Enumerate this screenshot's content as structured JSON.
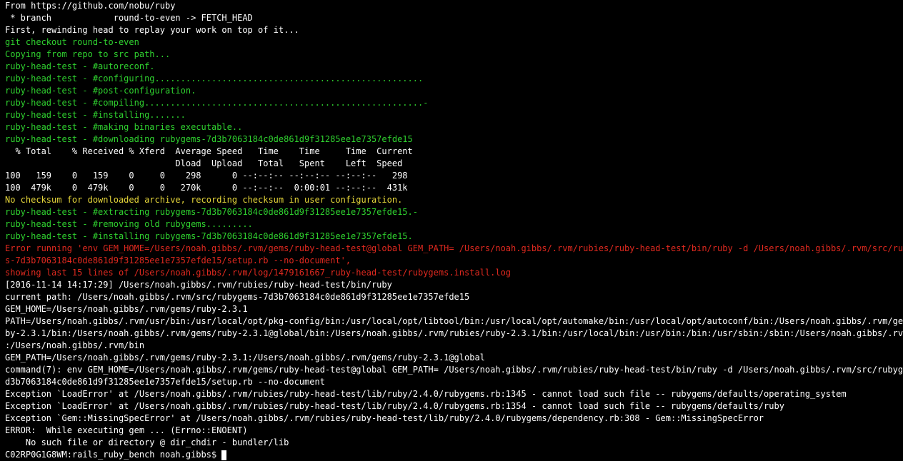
{
  "terminal": {
    "colors": {
      "background": "#000000",
      "default": "#ffffff",
      "green": "#2fd12f",
      "yellow": "#e5d63a",
      "red": "#e0291f"
    },
    "lines": [
      {
        "text": "From https://github.com/nobu/ruby",
        "color": "white"
      },
      {
        "text": " * branch            round-to-even -> FETCH_HEAD",
        "color": "white"
      },
      {
        "text": "First, rewinding head to replay your work on top of it...",
        "color": "white"
      },
      {
        "text": "git checkout round-to-even",
        "color": "green"
      },
      {
        "text": "Copying from repo to src path...",
        "color": "green"
      },
      {
        "text": "ruby-head-test - #autoreconf.",
        "color": "green"
      },
      {
        "text": "ruby-head-test - #configuring....................................................",
        "color": "green"
      },
      {
        "text": "ruby-head-test - #post-configuration.",
        "color": "green"
      },
      {
        "text": "ruby-head-test - #compiling......................................................-",
        "color": "green"
      },
      {
        "text": "ruby-head-test - #installing.......",
        "color": "green"
      },
      {
        "text": "ruby-head-test - #making binaries executable..",
        "color": "green"
      },
      {
        "text": "ruby-head-test - #downloading rubygems-7d3b7063184c0de861d9f31285ee1e7357efde15",
        "color": "green"
      },
      {
        "text": "  % Total    % Received % Xferd  Average Speed   Time    Time     Time  Current",
        "color": "white"
      },
      {
        "text": "                                 Dload  Upload   Total   Spent    Left  Speed",
        "color": "white"
      },
      {
        "text": "100   159    0   159    0     0    298      0 --:--:-- --:--:-- --:--:--   298",
        "color": "white"
      },
      {
        "text": "100  479k    0  479k    0     0   270k      0 --:--:--  0:00:01 --:--:--  431k",
        "color": "white"
      },
      {
        "text": "No checksum for downloaded archive, recording checksum in user configuration.",
        "color": "yellow"
      },
      {
        "text": "ruby-head-test - #extracting rubygems-7d3b7063184c0de861d9f31285ee1e7357efde15.-",
        "color": "green"
      },
      {
        "text": "ruby-head-test - #removing old rubygems.........",
        "color": "green"
      },
      {
        "text": "ruby-head-test - #installing rubygems-7d3b7063184c0de861d9f31285ee1e7357efde15.",
        "color": "green"
      },
      {
        "text": "Error running 'env GEM_HOME=/Users/noah.gibbs/.rvm/gems/ruby-head-test@global GEM_PATH= /Users/noah.gibbs/.rvm/rubies/ruby-head-test/bin/ruby -d /Users/noah.gibbs/.rvm/src/rubygem",
        "color": "red"
      },
      {
        "text": "s-7d3b7063184c0de861d9f31285ee1e7357efde15/setup.rb --no-document',",
        "color": "red"
      },
      {
        "text": "showing last 15 lines of /Users/noah.gibbs/.rvm/log/1479161667_ruby-head-test/rubygems.install.log",
        "color": "red"
      },
      {
        "text": "[2016-11-14 14:17:29] /Users/noah.gibbs/.rvm/rubies/ruby-head-test/bin/ruby",
        "color": "white"
      },
      {
        "text": "current path: /Users/noah.gibbs/.rvm/src/rubygems-7d3b7063184c0de861d9f31285ee1e7357efde15",
        "color": "white"
      },
      {
        "text": "GEM_HOME=/Users/noah.gibbs/.rvm/gems/ruby-2.3.1",
        "color": "white"
      },
      {
        "text": "PATH=/Users/noah.gibbs/.rvm/usr/bin:/usr/local/opt/pkg-config/bin:/usr/local/opt/libtool/bin:/usr/local/opt/automake/bin:/usr/local/opt/autoconf/bin:/Users/noah.gibbs/.rvm/gems/ru",
        "color": "white"
      },
      {
        "text": "by-2.3.1/bin:/Users/noah.gibbs/.rvm/gems/ruby-2.3.1@global/bin:/Users/noah.gibbs/.rvm/rubies/ruby-2.3.1/bin:/usr/local/bin:/usr/bin:/bin:/usr/sbin:/sbin:/Users/noah.gibbs/.rvm/bin",
        "color": "white"
      },
      {
        "text": ":/Users/noah.gibbs/.rvm/bin",
        "color": "white"
      },
      {
        "text": "GEM_PATH=/Users/noah.gibbs/.rvm/gems/ruby-2.3.1:/Users/noah.gibbs/.rvm/gems/ruby-2.3.1@global",
        "color": "white"
      },
      {
        "text": "command(7): env GEM_HOME=/Users/noah.gibbs/.rvm/gems/ruby-head-test@global GEM_PATH= /Users/noah.gibbs/.rvm/rubies/ruby-head-test/bin/ruby -d /Users/noah.gibbs/.rvm/src/rubygems-7",
        "color": "white"
      },
      {
        "text": "d3b7063184c0de861d9f31285ee1e7357efde15/setup.rb --no-document",
        "color": "white"
      },
      {
        "text": "Exception `LoadError' at /Users/noah.gibbs/.rvm/rubies/ruby-head-test/lib/ruby/2.4.0/rubygems.rb:1345 - cannot load such file -- rubygems/defaults/operating_system",
        "color": "white"
      },
      {
        "text": "Exception `LoadError' at /Users/noah.gibbs/.rvm/rubies/ruby-head-test/lib/ruby/2.4.0/rubygems.rb:1354 - cannot load such file -- rubygems/defaults/ruby",
        "color": "white"
      },
      {
        "text": "Exception `Gem::MissingSpecError' at /Users/noah.gibbs/.rvm/rubies/ruby-head-test/lib/ruby/2.4.0/rubygems/dependency.rb:308 - Gem::MissingSpecError",
        "color": "white"
      },
      {
        "text": "ERROR:  While executing gem ... (Errno::ENOENT)",
        "color": "white"
      },
      {
        "text": "    No such file or directory @ dir_chdir - bundler/lib",
        "color": "white"
      }
    ],
    "prompt": "C02RP0G1G8WM:rails_ruby_bench noah.gibbs$"
  }
}
